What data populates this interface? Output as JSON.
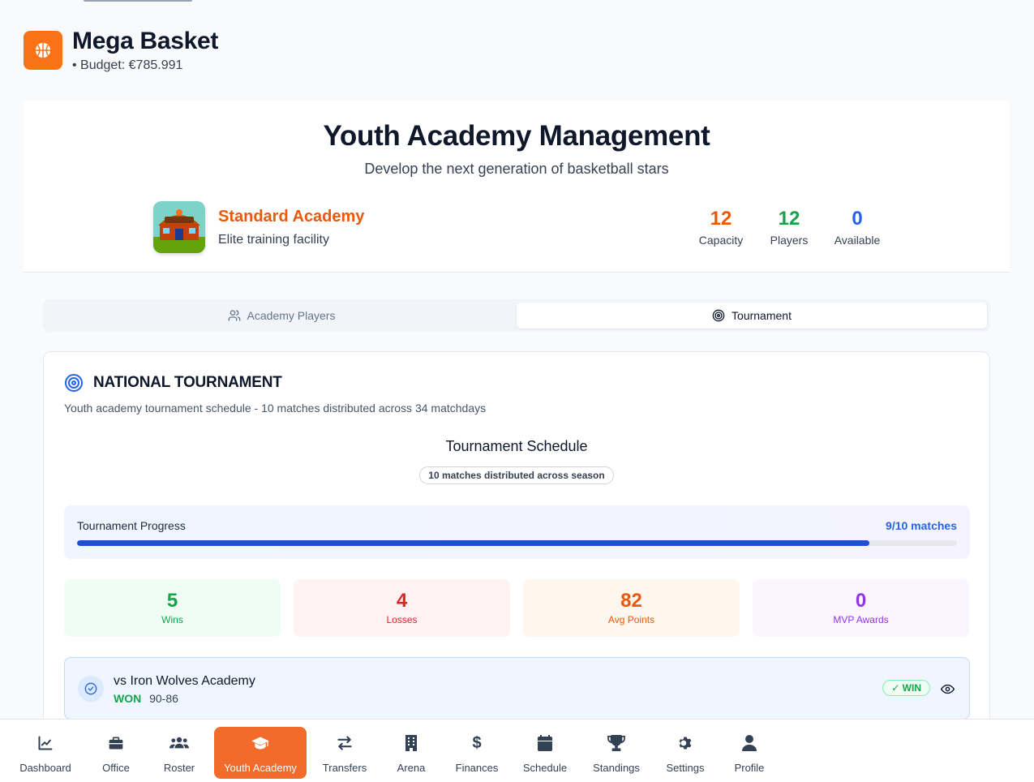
{
  "app": {
    "title": "Mega Basket",
    "budget": "• Budget: €785.991",
    "logo_icon": "basketball-icon"
  },
  "hero": {
    "title": "Youth Academy Management",
    "subtitle": "Develop the next generation of basketball stars",
    "academy_name": "Standard Academy",
    "academy_desc": "Elite training facility",
    "stats": [
      {
        "value": "12",
        "label": "Capacity",
        "color": "#ea580c"
      },
      {
        "value": "12",
        "label": "Players",
        "color": "#16a34a"
      },
      {
        "value": "0",
        "label": "Available",
        "color": "#2563eb"
      }
    ]
  },
  "tabs": [
    {
      "label": "Academy Players",
      "icon": "users-icon",
      "active": false
    },
    {
      "label": "Tournament",
      "icon": "target-icon",
      "active": true
    }
  ],
  "tournament": {
    "title": "NATIONAL TOURNAMENT",
    "description": "Youth academy tournament schedule - 10 matches distributed across 34 matchdays",
    "schedule_title": "Tournament Schedule",
    "schedule_badge": "10 matches distributed across season",
    "progress_label": "Tournament Progress",
    "progress_count": "9/10 matches",
    "progress_fraction": 0.9,
    "tiles": [
      {
        "value": "5",
        "label": "Wins",
        "bg": "#f0fdf4",
        "color": "#16a34a"
      },
      {
        "value": "4",
        "label": "Losses",
        "bg": "#fef2f2",
        "color": "#dc2626"
      },
      {
        "value": "82",
        "label": "Avg Points",
        "bg": "#fff7ed",
        "color": "#ea580c"
      },
      {
        "value": "0",
        "label": "MVP Awards",
        "bg": "#faf5ff",
        "color": "#9333ea"
      }
    ],
    "match": {
      "opponent": "vs Iron Wolves Academy",
      "result": "WON",
      "score": "90-86",
      "badge": "✓ WIN"
    }
  },
  "nav": [
    {
      "label": "Dashboard",
      "icon": "chart-line-icon",
      "active": false
    },
    {
      "label": "Office",
      "icon": "briefcase-icon",
      "active": false
    },
    {
      "label": "Roster",
      "icon": "users-icon",
      "active": false
    },
    {
      "label": "Youth Academy",
      "icon": "graduation-cap-icon",
      "active": true
    },
    {
      "label": "Transfers",
      "icon": "arrows-icon",
      "active": false
    },
    {
      "label": "Arena",
      "icon": "building-icon",
      "active": false
    },
    {
      "label": "Finances",
      "icon": "dollar-icon",
      "active": false
    },
    {
      "label": "Schedule",
      "icon": "calendar-icon",
      "active": false
    },
    {
      "label": "Standings",
      "icon": "trophy-icon",
      "active": false
    },
    {
      "label": "Settings",
      "icon": "gear-icon",
      "active": false
    },
    {
      "label": "Profile",
      "icon": "user-icon",
      "active": false
    }
  ]
}
